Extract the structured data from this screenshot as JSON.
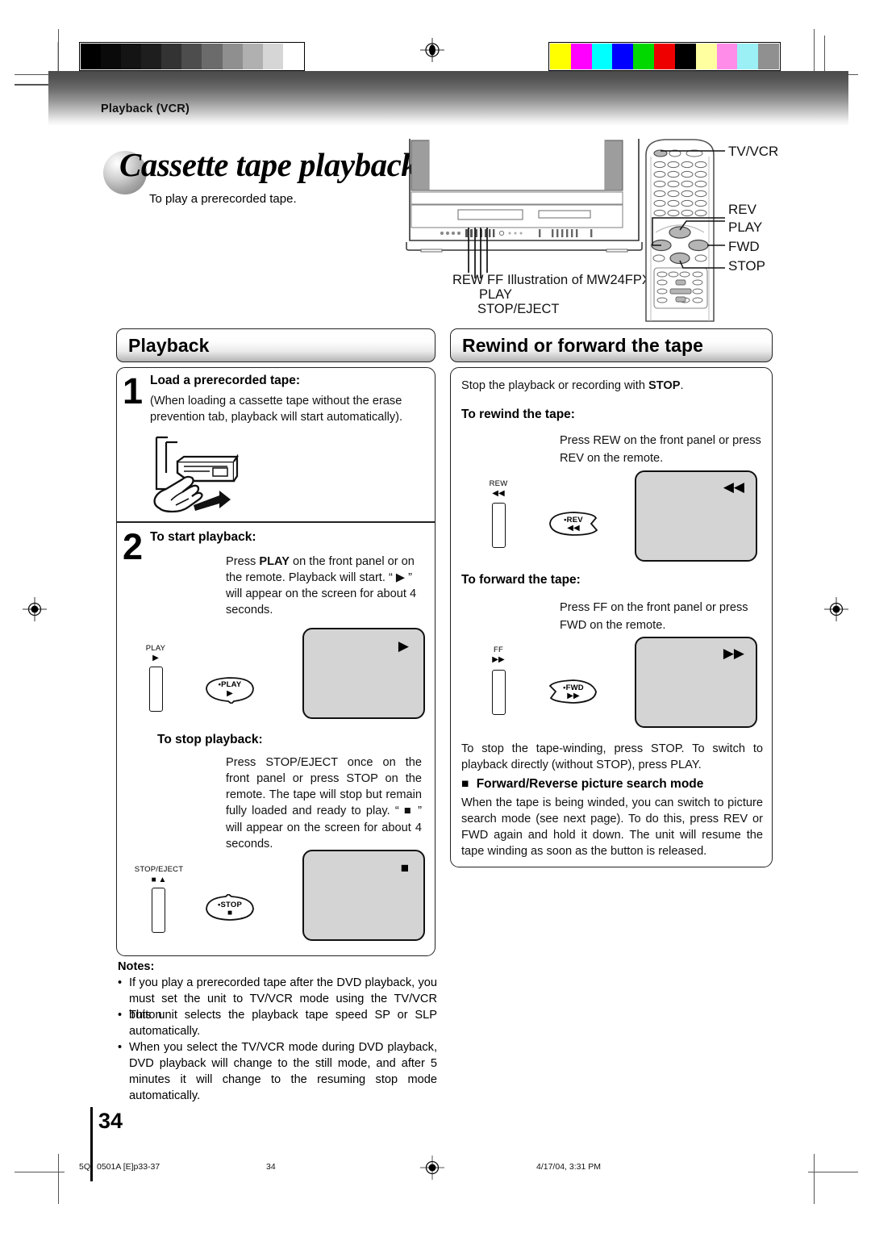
{
  "page": {
    "running_head": "Playback (VCR)",
    "title": "Cassette tape playback",
    "subtitle": "To play a prerecorded tape.",
    "page_number": "34"
  },
  "illustration": {
    "caption": "Illustration of MW24FPX",
    "front_panel_labels": [
      "REW",
      "FF",
      "PLAY",
      "STOP/EJECT"
    ],
    "remote_labels": [
      "TV/VCR",
      "REV",
      "PLAY",
      "FWD",
      "STOP"
    ]
  },
  "playback_section": {
    "heading": "Playback",
    "step1": {
      "number": "1",
      "title": "Load a prerecorded tape:",
      "body": "(When loading a cassette tape without the erase prevention tab, playback will start automatically)."
    },
    "step2": {
      "number": "2",
      "title": "To start playback:",
      "line1_pre": "Press ",
      "line1_bold": "PLAY",
      "line1_post": " on the front panel or on the remote.",
      "line2": "Playback will start. “ ▶ ” will appear on the screen for about 4 seconds.",
      "panel_button_caption": "PLAY",
      "panel_button_glyph": "▶",
      "remote_button_label": "•PLAY",
      "remote_button_glyph": "▶",
      "screen_icon": "▶"
    },
    "stop": {
      "title": "To stop playback:",
      "body": "Press STOP/EJECT once on the front panel or press STOP on the remote. The tape will stop but remain fully loaded and ready to play. “ ■ ” will appear on the screen for about 4 seconds.",
      "panel_button_caption": "STOP/EJECT",
      "panel_button_glyph": "■ ▲",
      "remote_button_label": "•STOP",
      "remote_button_glyph": "■",
      "screen_icon": "■"
    }
  },
  "rewind_section": {
    "heading": "Rewind or forward the tape",
    "intro_pre": "Stop the playback or recording with ",
    "intro_bold": "STOP",
    "intro_post": ".",
    "rewind": {
      "title": "To rewind the tape:",
      "line1": "Press REW on the front panel or press",
      "line2": "REV on the remote.",
      "panel_button_caption": "REW",
      "panel_button_glyph": "◀◀",
      "remote_button_label": "•REV",
      "remote_button_glyph": "◀◀",
      "screen_icon": "◀◀"
    },
    "forward": {
      "title": "To forward the tape:",
      "line1": "Press FF on the front panel or press",
      "line2": "FWD on the remote.",
      "panel_button_caption": "FF",
      "panel_button_glyph": "▶▶",
      "remote_button_label": "•FWD",
      "remote_button_glyph": "▶▶",
      "screen_icon": "▶▶"
    },
    "stop_note": "To stop the tape-winding, press STOP. To switch to playback directly (without STOP), press PLAY.",
    "search_mode": {
      "bullet": "■",
      "title": "Forward/Reverse picture search mode",
      "body": "When the tape is being winded, you can switch to picture search mode (see next page). To do this, press REV or FWD again and hold it down. The unit will resume the tape winding as soon as the button is released."
    }
  },
  "notes": {
    "title": "Notes:",
    "items": [
      "If you play a prerecorded tape after the DVD playback, you must set the unit to TV/VCR mode using the TV/VCR button.",
      "This unit selects the playback tape speed SP or SLP automatically.",
      "When you select the TV/VCR mode during DVD playback, DVD playback will change to the still mode, and after 5 minutes it will change to the resuming stop mode automatically."
    ],
    "bullet": "•"
  },
  "footer": {
    "job": "5Q",
    "file": "0501A [E]p33-37",
    "page": "34",
    "timestamp": "4/17/04, 3:31 PM"
  },
  "calibration": {
    "grayscale": [
      "#000000",
      "#0a0a0a",
      "#141414",
      "#1e1e1e",
      "#333333",
      "#4d4d4d",
      "#6b6b6b",
      "#8f8f8f",
      "#b0b0b0",
      "#d6d6d6",
      "#ffffff"
    ],
    "color": [
      "#ffff00",
      "#ff00ff",
      "#00ffff",
      "#0000ff",
      "#00d800",
      "#ee0000",
      "#000000",
      "#ffffa0",
      "#ff8ce8",
      "#9bf0f5",
      "#909090"
    ]
  }
}
